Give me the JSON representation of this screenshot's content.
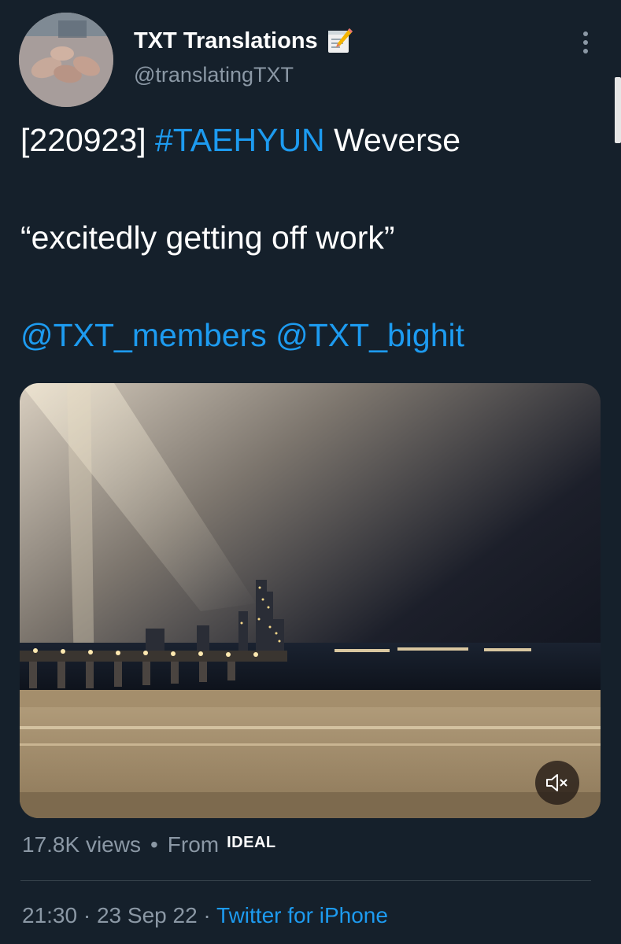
{
  "author": {
    "display_name": "TXT Translations",
    "name_emoji": "memo-icon",
    "handle": "@translatingTXT"
  },
  "tweet": {
    "prefix": "[220923] ",
    "hashtag": "#TAEHYUN",
    "after_hashtag": " Weverse",
    "quote": "“excitedly getting off work”",
    "mention_1": "@TXT_members",
    "mention_2": "@TXT_bighit"
  },
  "video": {
    "mute_icon": "speaker-muted-icon"
  },
  "stats": {
    "views": "17.8K views",
    "bullet": "•",
    "from_label": "From",
    "source": "IDEAL"
  },
  "meta": {
    "time": "21:30",
    "separator": "·",
    "date": "23 Sep 22",
    "client": "Twitter for iPhone"
  },
  "colors": {
    "background": "#15202b",
    "link": "#1d9bf0",
    "secondary_text": "#8b98a5"
  }
}
